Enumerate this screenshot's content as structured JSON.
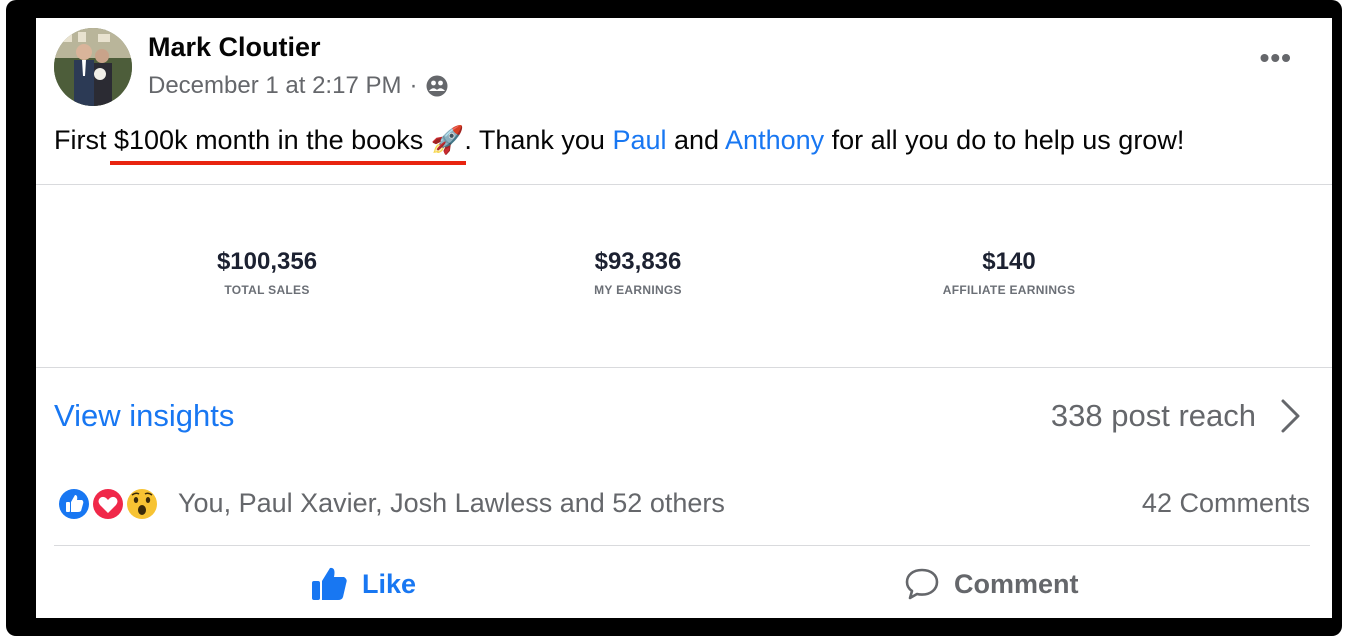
{
  "post": {
    "author": "Mark Cloutier",
    "timestamp": "December 1 at 2:17 PM",
    "separator": "·",
    "audience_icon": "friends-icon",
    "more_icon": "more-options-icon",
    "text_before": "First ",
    "text_highlight": "$100k month in the books ",
    "text_emoji": "🚀",
    "text_mid1": ". Thank you ",
    "mention1": "Paul",
    "text_mid2": " and ",
    "mention2": "Anthony",
    "text_end": " for all you do to help us grow!"
  },
  "stats": [
    {
      "value": "$100,356",
      "label": "TOTAL SALES"
    },
    {
      "value": "$93,836",
      "label": "MY EARNINGS"
    },
    {
      "value": "$140",
      "label": "AFFILIATE EARNINGS"
    }
  ],
  "insights": {
    "link": "View insights",
    "reach": "338 post reach"
  },
  "engagement": {
    "reaction_icons": [
      "like-icon",
      "love-icon",
      "wow-icon"
    ],
    "names": "You, Paul Xavier, Josh Lawless and 52 others",
    "comments": "42 Comments"
  },
  "actions": {
    "like": "Like",
    "comment": "Comment"
  },
  "colors": {
    "brand_blue": "#1877f2",
    "underline_red": "#e8240f",
    "secondary_text": "#65676b"
  }
}
